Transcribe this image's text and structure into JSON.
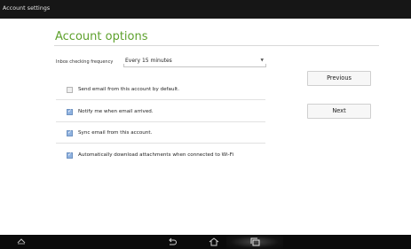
{
  "titlebar": {
    "title": "Account settings"
  },
  "page": {
    "heading": "Account options"
  },
  "frequency": {
    "label": "Inbox checking frequency",
    "value": "Every 15 minutes"
  },
  "options": [
    {
      "label": "Send email from this account by default.",
      "checked": false
    },
    {
      "label": "Notify me when email arrived.",
      "checked": true
    },
    {
      "label": "Sync email from this account.",
      "checked": true
    },
    {
      "label": "Automatically download attachments when connected to Wi-Fi",
      "checked": true
    }
  ],
  "buttons": {
    "previous": "Previous",
    "next": "Next"
  },
  "navbar": {
    "icons": [
      "chevron-up-icon",
      "back-icon",
      "home-icon",
      "recent-apps-icon"
    ]
  }
}
